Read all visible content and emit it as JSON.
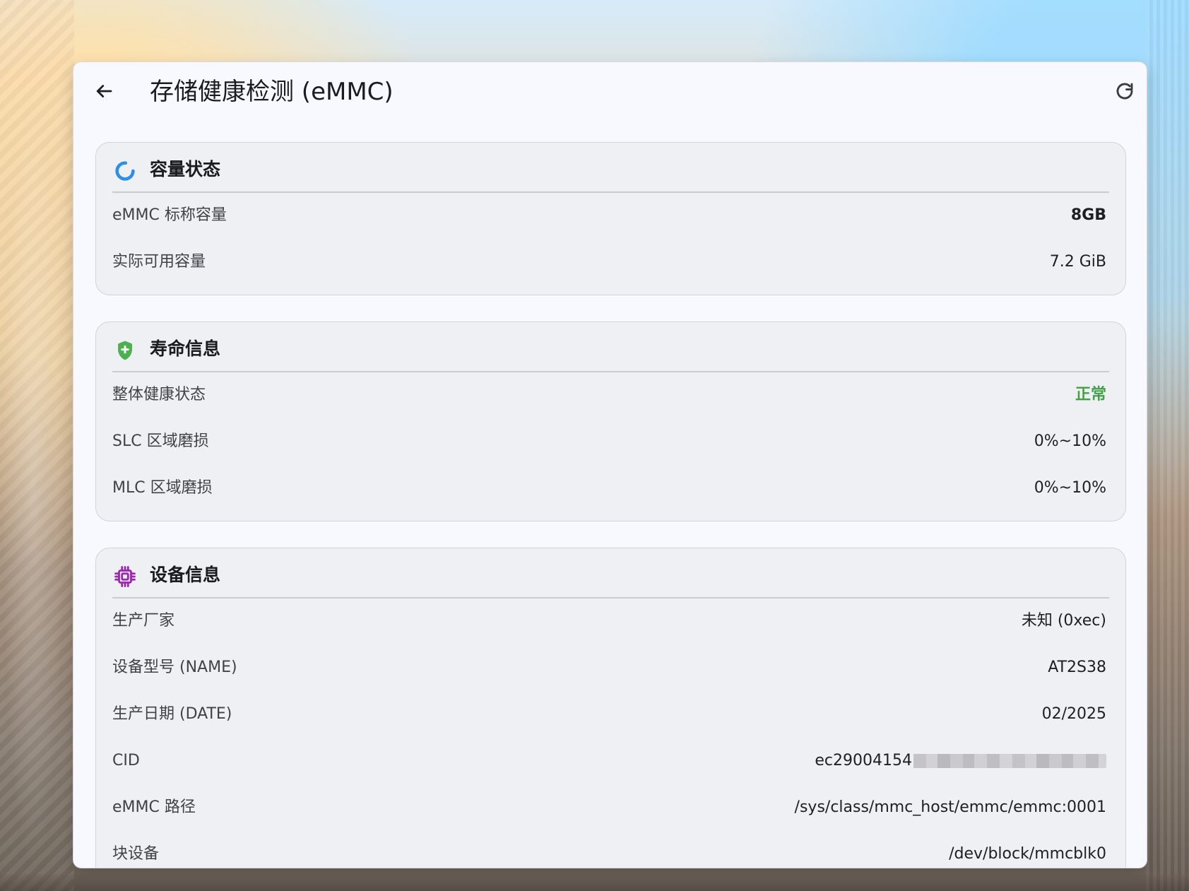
{
  "header": {
    "title": "存储健康检测 (eMMC)",
    "back_icon": "arrow-left-icon",
    "refresh_icon": "refresh-icon"
  },
  "colors": {
    "capacity_accent": "#2f8fe6",
    "life_accent": "#4caf50",
    "device_accent": "#9c27b0",
    "status_ok": "#43a047"
  },
  "sections": {
    "capacity": {
      "title": "容量状态",
      "icon": "capacity-ring-icon",
      "rows": [
        {
          "label": "eMMC 标称容量",
          "value": "8GB"
        },
        {
          "label": "实际可用容量",
          "value": "7.2 GiB"
        }
      ]
    },
    "life": {
      "title": "寿命信息",
      "icon": "shield-plus-icon",
      "rows": [
        {
          "label": "整体健康状态",
          "value": "正常"
        },
        {
          "label": "SLC 区域磨损",
          "value": "0%~10%"
        },
        {
          "label": "MLC 区域磨损",
          "value": "0%~10%"
        }
      ]
    },
    "device": {
      "title": "设备信息",
      "icon": "chip-icon",
      "rows": [
        {
          "label": "生产厂家",
          "value": "未知 (0xec)"
        },
        {
          "label": "设备型号 (NAME)",
          "value": "AT2S38"
        },
        {
          "label": "生产日期 (DATE)",
          "value": "02/2025"
        },
        {
          "label": "CID",
          "value": "ec29004154"
        },
        {
          "label": "eMMC 路径",
          "value": "/sys/class/mmc_host/emmc/emmc:0001"
        },
        {
          "label": "块设备",
          "value": "/dev/block/mmcblk0"
        }
      ]
    }
  }
}
